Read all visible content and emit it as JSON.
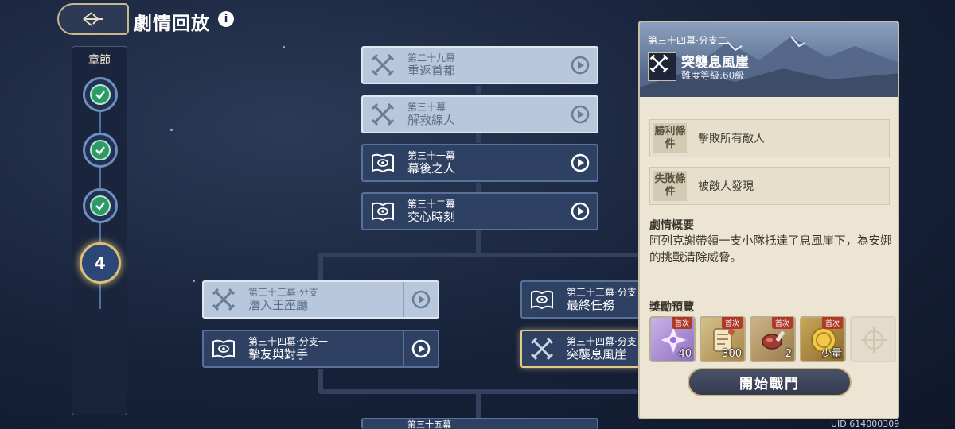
{
  "header": {
    "title": "劇情回放",
    "info_glyph": "i"
  },
  "chapter_rail": {
    "label": "章節",
    "chapters": [
      {
        "state": "cleared",
        "icon": "check-icon"
      },
      {
        "state": "cleared",
        "icon": "check-icon"
      },
      {
        "state": "cleared",
        "icon": "check-icon"
      },
      {
        "state": "current",
        "number": "4"
      }
    ]
  },
  "episodes": [
    {
      "episode": "第二十九幕",
      "name": "重返首都",
      "state": "cleared",
      "icon": "crossed-swords-icon"
    },
    {
      "episode": "第三十幕",
      "name": "解救線人",
      "state": "cleared",
      "icon": "crossed-swords-icon"
    },
    {
      "episode": "第三十一幕",
      "name": "幕後之人",
      "state": "available",
      "icon": "book-eye-icon"
    },
    {
      "episode": "第三十二幕",
      "name": "交心時刻",
      "state": "available",
      "icon": "book-eye-icon"
    },
    {
      "episode": "第三十三幕·分支一",
      "name": "潛入王座廳",
      "state": "cleared",
      "icon": "crossed-swords-icon"
    },
    {
      "episode": "第三十四幕·分支一",
      "name": "摯友與對手",
      "state": "available",
      "icon": "book-eye-icon"
    },
    {
      "episode": "第三十三幕·分支",
      "name": "最終任務",
      "state": "available",
      "icon": "book-eye-icon"
    },
    {
      "episode": "第三十四幕·分支",
      "name": "突襲息風崖",
      "state": "selected",
      "icon": "crossed-swords-icon"
    },
    {
      "episode": "第三十五幕",
      "name": "",
      "state": "available",
      "icon": ""
    }
  ],
  "detail": {
    "subtitle": "第三十四幕·分支二",
    "title": "突襲息風崖",
    "difficulty": "難度等級:60級",
    "victory": {
      "tag": "勝利條件",
      "value": "擊敗所有敵人"
    },
    "defeat": {
      "tag": "失敗條件",
      "value": "被敵人發現"
    },
    "summary_title": "劇情概要",
    "summary": "阿列克謝帶領一支小隊抵達了息風崖下，為安娜的挑戰清除威脅。",
    "rewards_title": "獎勵預覽",
    "rewards": [
      {
        "item": "star-crystal-icon",
        "badge": "首次",
        "qty": "40",
        "bg": "#9c7fc4"
      },
      {
        "item": "scroll-icon",
        "badge": "首次",
        "qty": "300",
        "bg": "#b89a5e"
      },
      {
        "item": "meat-icon",
        "badge": "首次",
        "qty": "2",
        "bg": "#a88756"
      },
      {
        "item": "gold-coin-icon",
        "badge": "首次",
        "qty": "少量",
        "bg": "#9d7a3a"
      },
      {
        "item": "empty-slot-icon",
        "badge": "",
        "qty": "",
        "bg": "#e3dccb"
      }
    ],
    "start_button": "開始戰鬥"
  },
  "uid": "UID 614000309",
  "colors": {
    "gold": "#e3c98a",
    "panel": "#ece5d4",
    "card": "#2f4163",
    "cleared": "#b8c8dc"
  }
}
